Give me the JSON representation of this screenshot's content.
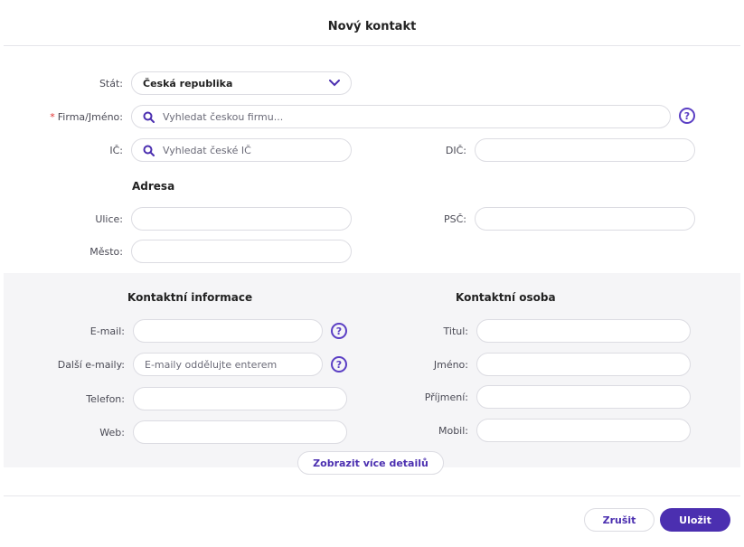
{
  "dialog": {
    "title": "Nový kontakt"
  },
  "company": {
    "country_label": "Stát:",
    "country_value": "Česká republika",
    "name_required_mark": "*",
    "name_label": "Firma/Jméno:",
    "name_placeholder": "Vyhledat českou firmu...",
    "ic_label": "IČ:",
    "ic_placeholder": "Vyhledat české IČ",
    "dic_label": "DIČ:",
    "dic_value": ""
  },
  "address": {
    "section_title": "Adresa",
    "street_label": "Ulice:",
    "street_value": "",
    "zip_label": "PSČ:",
    "zip_value": "",
    "city_label": "Město:",
    "city_value": ""
  },
  "contact_info": {
    "section_title": "Kontaktní informace",
    "email_label": "E-mail:",
    "email_value": "",
    "other_emails_label": "Další e-maily:",
    "other_emails_placeholder": "E-maily oddělujte enterem",
    "phone_label": "Telefon:",
    "phone_value": "",
    "web_label": "Web:",
    "web_value": ""
  },
  "contact_person": {
    "section_title": "Kontaktní osoba",
    "title_label": "Titul:",
    "title_value": "",
    "first_name_label": "Jméno:",
    "first_name_value": "",
    "last_name_label": "Příjmení:",
    "last_name_value": "",
    "mobile_label": "Mobil:",
    "mobile_value": ""
  },
  "actions": {
    "more_details": "Zobrazit více detailů",
    "cancel": "Zrušit",
    "save": "Uložit",
    "help_glyph": "?"
  },
  "colors": {
    "accent": "#4b2fb0",
    "required": "#e03030",
    "section_bg": "#f5f5f7"
  },
  "icons": {
    "search": "search-icon",
    "chevron": "chevron-down-icon",
    "help": "help-icon"
  }
}
